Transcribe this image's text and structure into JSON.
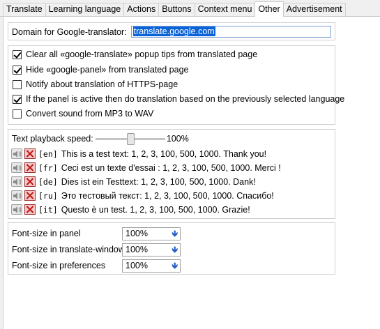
{
  "tabs": [
    "Translate",
    "Learning language",
    "Actions",
    "Buttons",
    "Context menu",
    "Other",
    "Advertisement"
  ],
  "active_tab": "Other",
  "domain": {
    "label": "Domain for Google-translator:",
    "value": "translate.google.com"
  },
  "options": [
    {
      "label": "Clear all «google-translate» popup tips from translated page",
      "checked": true
    },
    {
      "label": "Hide «google-panel» from translated page",
      "checked": true
    },
    {
      "label": "Notify about translation of HTTPS-page",
      "checked": false
    },
    {
      "label": "If the panel is active then do translation based on the previously selected language",
      "checked": true
    },
    {
      "label": "Convert sound from MP3 to WAV",
      "checked": false
    }
  ],
  "playback": {
    "label": "Text playback speed:",
    "value_text": "100%",
    "slider_fraction": 0.5
  },
  "samples": [
    {
      "code": "[en]",
      "text": "This is a test text: 1, 2, 3, 100, 500, 1000. Thank you!"
    },
    {
      "code": "[fr]",
      "text": "Ceci est un texte d'essai : 1, 2, 3, 100, 500, 1000. Merci !"
    },
    {
      "code": "[de]",
      "text": "Dies ist ein Testtext: 1, 2, 3, 100, 500, 1000. Dank!"
    },
    {
      "code": "[ru]",
      "text": "Это тестовый текст: 1, 2, 3, 100, 500, 1000. Спасибо!"
    },
    {
      "code": "[it]",
      "text": "Questo è un test. 1, 2, 3, 100, 500, 1000. Grazie!"
    }
  ],
  "font_sizes": [
    {
      "label": "Font-size in panel",
      "value": "100%"
    },
    {
      "label": "Font-size in translate-window",
      "value": "100%"
    },
    {
      "label": "Font-size in preferences",
      "value": "100%"
    }
  ],
  "icons": {
    "play": "speaker-icon",
    "stop": "stop-x-icon",
    "dropdown": "arrow-down-icon"
  }
}
